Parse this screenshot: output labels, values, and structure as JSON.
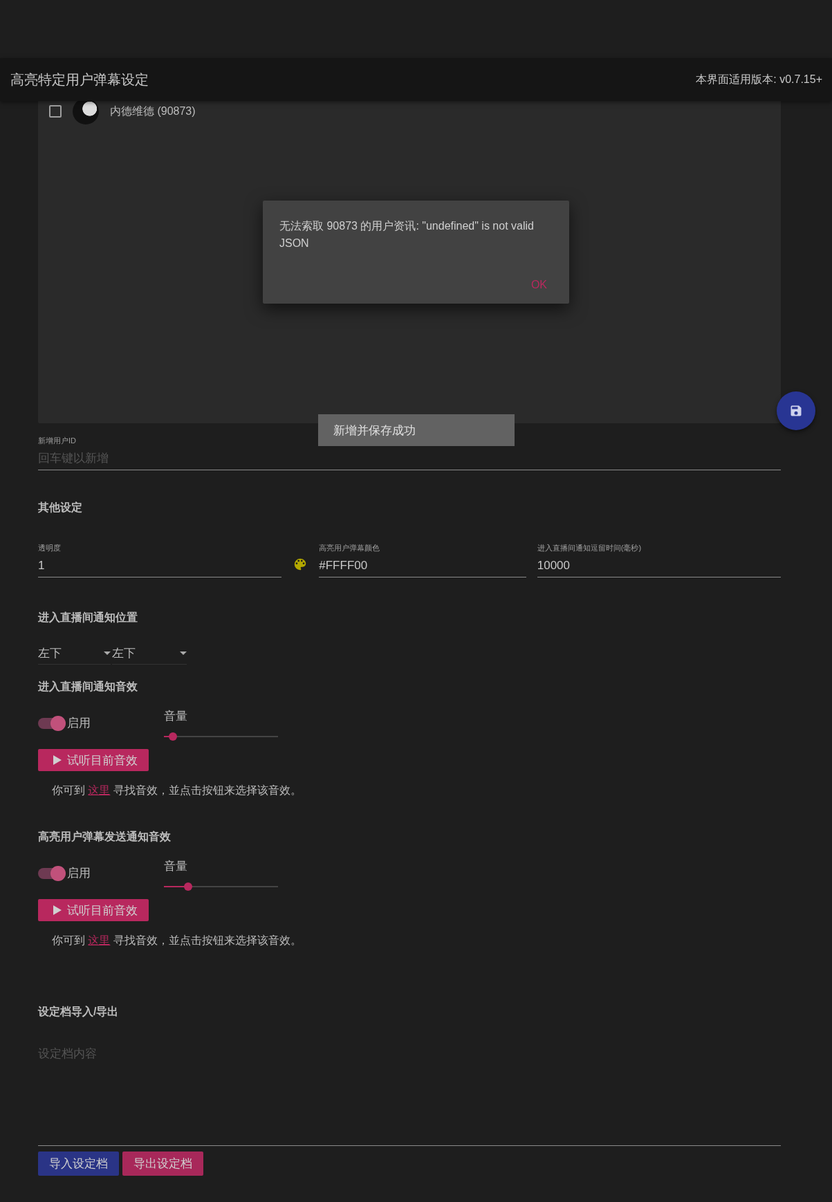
{
  "app_bar": {
    "title": "高亮特定用户弹幕设定",
    "version": "本界面适用版本: v0.7.15+"
  },
  "user_list": {
    "users": [
      {
        "name": "内德维德 (90873)",
        "checked": false
      }
    ]
  },
  "new_user_field": {
    "label": "新增用户ID",
    "placeholder": "回车键以新增"
  },
  "other_settings": {
    "title": "其他设定",
    "fields": [
      {
        "kind": "text",
        "label": "透明度",
        "value": "1"
      },
      {
        "kind": "color",
        "label": "高亮用户弹幕颜色",
        "value": "#FFFF00"
      },
      {
        "kind": "text",
        "label": "进入直播间通知逗留时间(毫秒)",
        "value": "10000"
      }
    ]
  },
  "position": {
    "title": "进入直播间通知位置",
    "selects": [
      {
        "value": "左下"
      },
      {
        "value": "左下"
      }
    ]
  },
  "sound_sections": [
    {
      "title": "进入直播间通知音效",
      "toggle": {
        "label": "启用",
        "on": true
      },
      "volume": {
        "label": "音量",
        "level": 0.08
      },
      "preview_button": "试听目前音效",
      "hint": {
        "before": "你可到 ",
        "link": "这里",
        "after": " 寻找音效，並点击按钮来选择该音效。"
      }
    },
    {
      "title": "高亮用户弹幕发送通知音效",
      "toggle": {
        "label": "启用",
        "on": true
      },
      "volume": {
        "label": "音量",
        "level": 0.21
      },
      "preview_button": "试听目前音效",
      "hint": {
        "before": "你可到 ",
        "link": "这里",
        "after": " 寻找音效，並点击按钮来选择该音效。"
      }
    }
  ],
  "import_export": {
    "title": "设定档导入/导出",
    "placeholder": "设定档内容",
    "buttons": [
      {
        "label": "导入设定档",
        "kind": "import"
      },
      {
        "label": "导出设定档",
        "kind": "export"
      }
    ]
  },
  "dialog": {
    "message": "无法索取 90873 的用户资讯: \"undefined\" is not valid JSON",
    "button": "OK"
  },
  "snackbar": {
    "message": "新增并保存成功"
  }
}
